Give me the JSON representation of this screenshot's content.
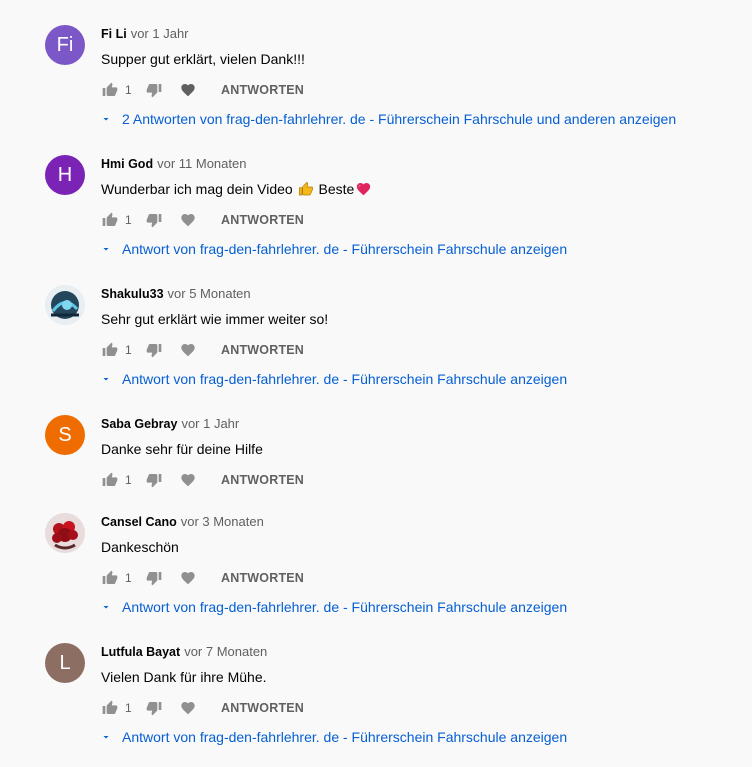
{
  "colors": {
    "link": "#065fd4",
    "meta": "#606060",
    "icon": "#909090"
  },
  "comments": [
    {
      "author": "Fi Li",
      "time": "vor 1 Jahr",
      "avatar": {
        "type": "initials",
        "text": "Fi",
        "color": "#7b57c8"
      },
      "text": "Supper gut erklärt, vielen Dank!!!",
      "likes": "1",
      "reply_label": "ANTWORTEN",
      "replies_label": "2 Antworten von frag-den-fahrlehrer. de - Führerschein Fahrschule und anderen anzeigen"
    },
    {
      "author": "Hmi God",
      "time": "vor 11 Monaten",
      "avatar": {
        "type": "initials",
        "text": "H",
        "color": "#7b23b5"
      },
      "text": "Wunderbar ich mag dein Video",
      "text_after": "Beste",
      "likes": "1",
      "reply_label": "ANTWORTEN",
      "replies_label": "Antwort von frag-den-fahrlehrer. de - Führerschein Fahrschule anzeigen"
    },
    {
      "author": "Shakulu33",
      "time": "vor 5 Monaten",
      "avatar": {
        "type": "image",
        "text": "",
        "color": "#2c3e50"
      },
      "text": "Sehr gut erklärt wie immer weiter so!",
      "likes": "1",
      "reply_label": "ANTWORTEN",
      "replies_label": "Antwort von frag-den-fahrlehrer. de - Führerschein Fahrschule anzeigen"
    },
    {
      "author": "Saba Gebray",
      "time": "vor 1 Jahr",
      "avatar": {
        "type": "initials",
        "text": "S",
        "color": "#ef6c00"
      },
      "text": "Danke sehr für deine Hilfe",
      "likes": "1",
      "reply_label": "ANTWORTEN",
      "replies_label": ""
    },
    {
      "author": "Cansel Cano",
      "time": "vor 3 Monaten",
      "avatar": {
        "type": "image",
        "text": "",
        "color": "#8a1c1c"
      },
      "text": "Dankeschön",
      "likes": "1",
      "reply_label": "ANTWORTEN",
      "replies_label": "Antwort von frag-den-fahrlehrer. de - Führerschein Fahrschule anzeigen"
    },
    {
      "author": "Lutfula Bayat",
      "time": "vor 7 Monaten",
      "avatar": {
        "type": "initials",
        "text": "L",
        "color": "#8d6e63"
      },
      "text": "Vielen Dank für ihre Mühe.",
      "likes": "1",
      "reply_label": "ANTWORTEN",
      "replies_label": "Antwort von frag-den-fahrlehrer. de - Führerschein Fahrschule anzeigen"
    }
  ]
}
